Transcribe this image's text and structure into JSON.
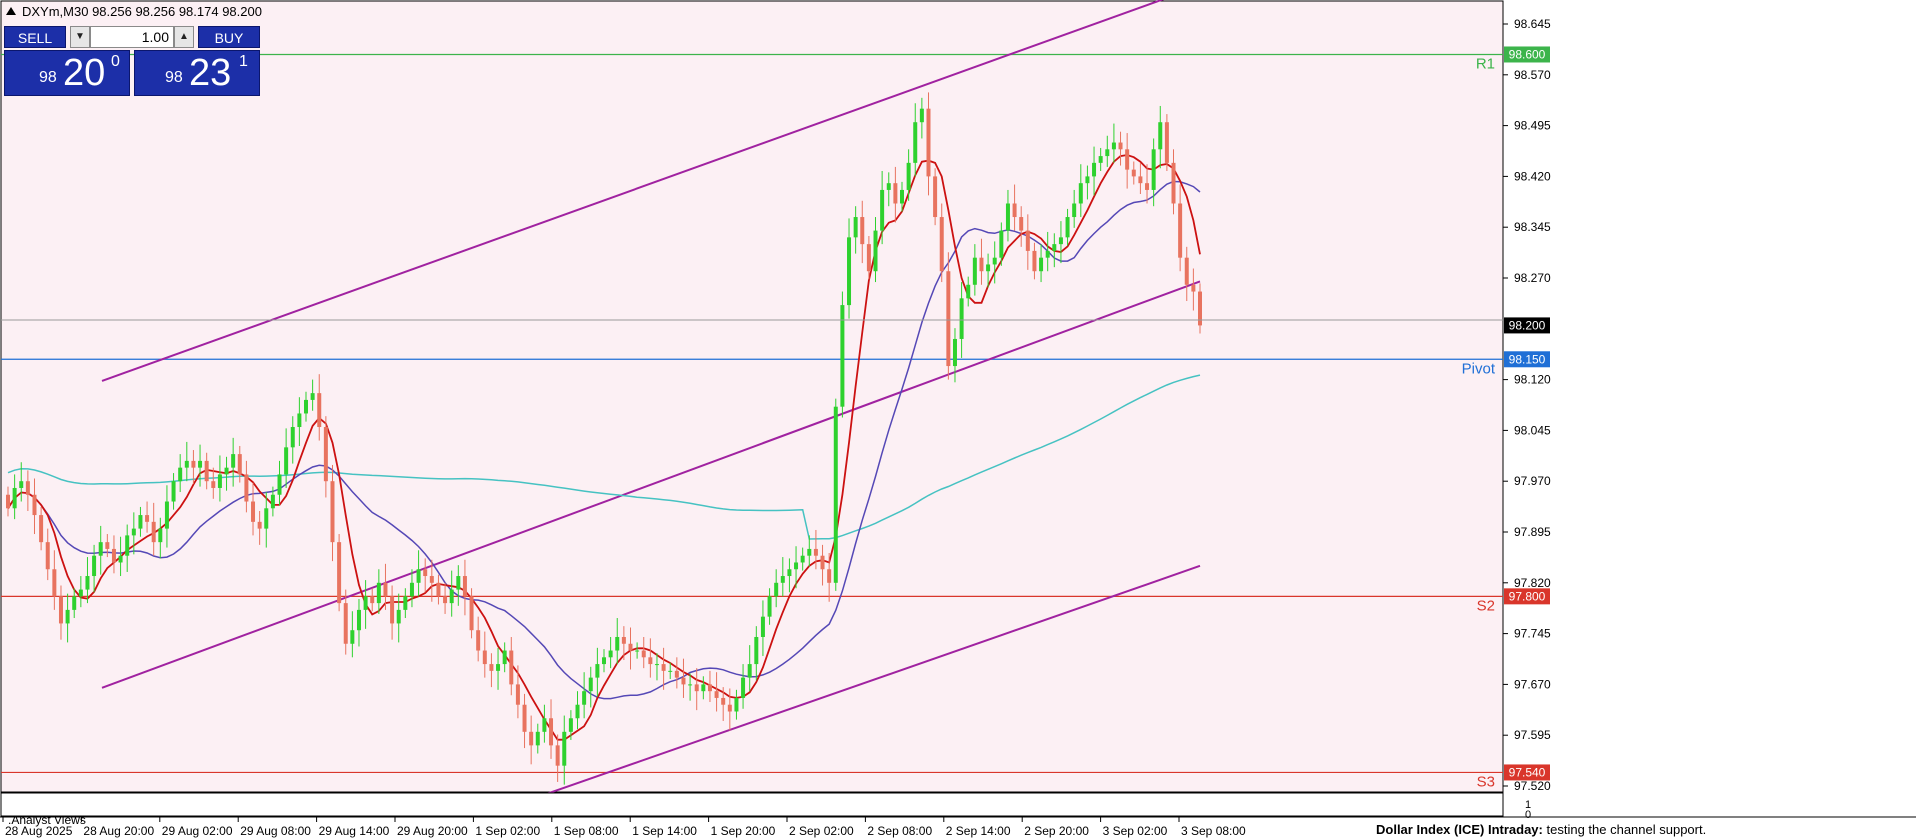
{
  "window": {
    "symbol_header": "DXYm,M30  98.256 98.256 98.174 98.200"
  },
  "trade_panel": {
    "sell_label": "SELL",
    "buy_label": "BUY",
    "lot_value": "1.00",
    "sell_quote": {
      "prefix": "98",
      "big": "20",
      "sup": "0"
    },
    "buy_quote": {
      "prefix": "98",
      "big": "23",
      "sup": "1"
    }
  },
  "price_axis": {
    "ticks": [
      "98.645",
      "98.570",
      "98.495",
      "98.420",
      "98.345",
      "98.270",
      "98.120",
      "98.045",
      "97.970",
      "97.895",
      "97.820",
      "97.745",
      "97.670",
      "97.595",
      "97.520"
    ],
    "current_price": "98.200"
  },
  "levels": [
    {
      "name": "R1",
      "price": 98.6,
      "tag": "98.600",
      "color": "#3cb44b"
    },
    {
      "name": "Pivot",
      "price": 98.15,
      "tag": "98.150",
      "color": "#1f6fd6"
    },
    {
      "name": "S2",
      "price": 97.8,
      "tag": "97.800",
      "color": "#d9362b"
    },
    {
      "name": "S3",
      "price": 97.54,
      "tag": "97.540",
      "color": "#d9362b"
    }
  ],
  "time_axis": {
    "labels": [
      "28 Aug 2025",
      "28 Aug 20:00",
      "29 Aug 02:00",
      "29 Aug 08:00",
      "29 Aug 14:00",
      "29 Aug 20:00",
      "1 Sep 02:00",
      "1 Sep 08:00",
      "1 Sep 14:00",
      "1 Sep 20:00",
      "2 Sep 02:00",
      "2 Sep 08:00",
      "2 Sep 14:00",
      "2 Sep 20:00",
      "3 Sep 02:00",
      "3 Sep 08:00"
    ]
  },
  "subwindow": {
    "label": ".Analyst Views",
    "scale_top": "1",
    "scale_bottom": "0",
    "comment_bold": "Dollar Index (ICE) Intraday:",
    "comment_text": "testing the channel support."
  },
  "colors": {
    "background": "#fcf0f4",
    "bull": "#2ed12e",
    "bear": "#e8735f",
    "channel": "#a022a0",
    "ma_fast": "#cc1111",
    "ma_mid": "#5548b6",
    "ma_slow": "#46c2c2"
  },
  "chart_data": {
    "type": "candlestick",
    "symbol": "DXYm",
    "timeframe": "M30",
    "ylim": [
      97.5,
      98.7
    ],
    "xlabel": "",
    "ylabel": "",
    "grid": false,
    "ohlc_last": {
      "open": 98.256,
      "high": 98.256,
      "low": 98.174,
      "close": 98.2
    },
    "closes": [
      97.93,
      97.96,
      97.97,
      97.95,
      97.92,
      97.88,
      97.84,
      97.8,
      97.76,
      97.78,
      97.8,
      97.81,
      97.83,
      97.86,
      97.88,
      97.87,
      97.85,
      97.86,
      97.89,
      97.9,
      97.92,
      97.91,
      97.88,
      97.9,
      97.94,
      97.97,
      97.99,
      98.0,
      97.99,
      98.0,
      97.97,
      97.96,
      97.98,
      97.99,
      98.01,
      97.98,
      97.94,
      97.91,
      97.9,
      97.93,
      97.95,
      97.98,
      98.02,
      98.05,
      98.07,
      98.09,
      98.1,
      98.05,
      97.97,
      97.88,
      97.79,
      97.73,
      97.75,
      97.78,
      97.8,
      97.79,
      97.82,
      97.8,
      97.76,
      97.78,
      97.8,
      97.82,
      97.84,
      97.83,
      97.82,
      97.8,
      97.79,
      97.81,
      97.83,
      97.8,
      97.75,
      97.72,
      97.7,
      97.69,
      97.7,
      97.72,
      97.67,
      97.64,
      97.6,
      97.58,
      97.6,
      97.62,
      97.58,
      97.55,
      97.6,
      97.62,
      97.64,
      97.66,
      97.68,
      97.7,
      97.71,
      97.72,
      97.74,
      97.73,
      97.72,
      97.72,
      97.71,
      97.7,
      97.7,
      97.69,
      97.69,
      97.68,
      97.67,
      97.67,
      97.66,
      97.67,
      97.66,
      97.65,
      97.64,
      97.63,
      97.65,
      97.68,
      97.7,
      97.74,
      97.77,
      97.8,
      97.82,
      97.83,
      97.84,
      97.85,
      97.86,
      97.87,
      97.86,
      97.84,
      97.82,
      98.08,
      98.23,
      98.33,
      98.36,
      98.32,
      98.28,
      98.34,
      98.4,
      98.41,
      98.38,
      98.4,
      98.44,
      98.5,
      98.52,
      98.42,
      98.36,
      98.28,
      98.14,
      98.18,
      98.24,
      98.26,
      98.3,
      98.28,
      98.29,
      98.3,
      98.34,
      98.38,
      98.36,
      98.34,
      98.31,
      98.28,
      98.3,
      98.31,
      98.32,
      98.33,
      98.36,
      98.38,
      98.41,
      98.42,
      98.44,
      98.45,
      98.46,
      98.47,
      98.46,
      98.43,
      98.42,
      98.41,
      98.4,
      98.46,
      98.5,
      98.44,
      98.38,
      98.3,
      98.26,
      98.25,
      98.2
    ]
  }
}
